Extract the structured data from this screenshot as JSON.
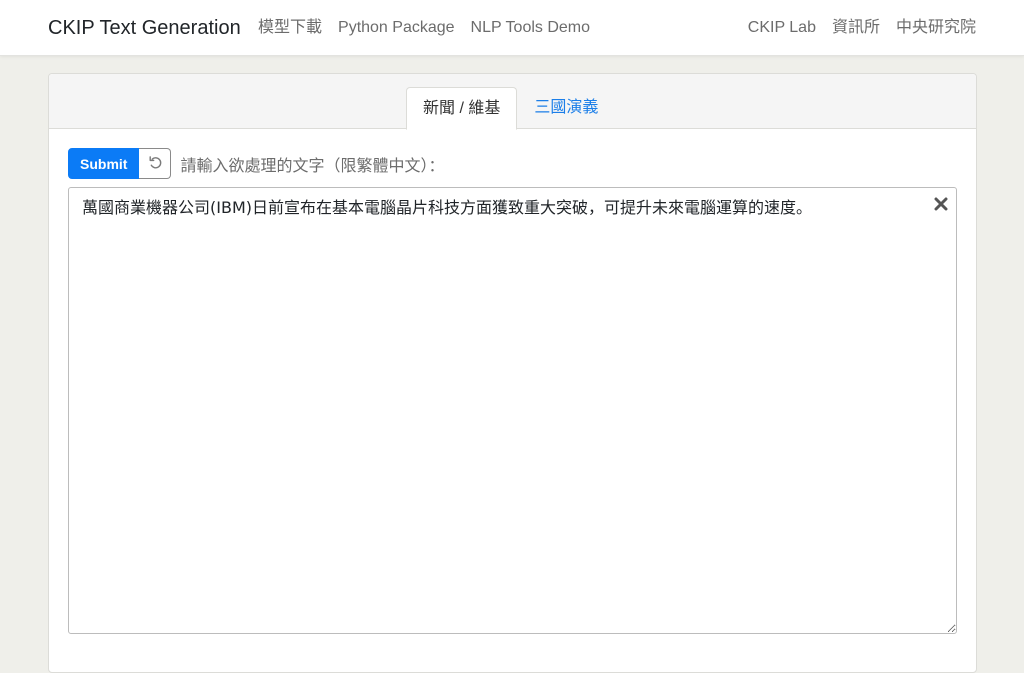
{
  "navbar": {
    "brand": "CKIP Text Generation",
    "left_links": [
      "模型下載",
      "Python Package",
      "NLP Tools Demo"
    ],
    "right_links": [
      "CKIP Lab",
      "資訊所",
      "中央研究院"
    ]
  },
  "tabs": [
    {
      "label": "新聞 / 維基",
      "active": true
    },
    {
      "label": "三國演義",
      "active": false
    }
  ],
  "form": {
    "submit_label": "Submit",
    "reset_icon": "undo-icon",
    "instruction": "請輸入欲處理的文字（限繁體中文）：",
    "input_value": "萬國商業機器公司(IBM)日前宣布在基本電腦晶片科技方面獲致重大突破，可提升未來電腦運算的速度。",
    "clear_icon": "close-icon"
  },
  "colors": {
    "accent": "#0b7bf6",
    "link": "#1b7ee8",
    "background": "#efefea"
  }
}
